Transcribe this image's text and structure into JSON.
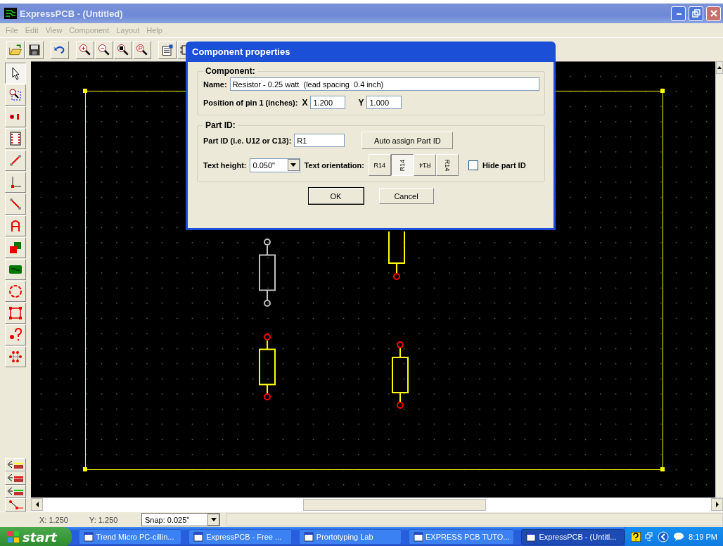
{
  "window": {
    "title": "ExpressPCB - (Untitled)"
  },
  "menu": [
    "File",
    "Edit",
    "View",
    "Component",
    "Layout",
    "Help"
  ],
  "tools": [
    {
      "selected": true
    },
    {
      "selected": false
    },
    {
      "selected": false
    },
    {
      "selected": false
    },
    {
      "selected": false
    },
    {
      "selected": false
    },
    {
      "selected": false
    },
    {
      "selected": false
    },
    {
      "selected": false
    },
    {
      "selected": false
    },
    {
      "selected": false
    },
    {
      "selected": false
    },
    {
      "selected": false
    },
    {
      "selected": false
    }
  ],
  "components": [
    {
      "selected": true
    },
    {
      "selected": false
    },
    {
      "selected": false
    },
    {
      "selected": false
    }
  ],
  "dialog": {
    "title": "Component properties",
    "component_group": {
      "label": "Component:",
      "name_label": "Name:",
      "name_value": "Resistor - 0.25 watt  (lead spacing  0.4 inch)",
      "position_label": "Position of pin 1 (inches):",
      "x_label": "X",
      "x_value": "1.200",
      "y_label": "Y",
      "y_value": "1.000"
    },
    "part_group": {
      "label": "Part ID:",
      "part_id_label": "Part ID (i.e. U12 or C13):",
      "part_id_value": "R1",
      "auto_button": "Auto assign Part ID",
      "text_height_label": "Text height:",
      "text_height_value": "0.050\"",
      "orientation_label": "Text orientation:",
      "orientations": [
        {
          "label": "R14",
          "kind": "upright",
          "selected": false
        },
        {
          "label": "R14",
          "kind": "ccw",
          "selected": true
        },
        {
          "label": "R14",
          "kind": "flipped",
          "selected": false
        },
        {
          "label": "R14",
          "kind": "cw",
          "selected": false
        }
      ],
      "hide_label": "Hide part ID",
      "hide_checked": false
    },
    "buttons": [
      "OK",
      "Cancel"
    ]
  },
  "status_bar": {
    "x": "X: 1.250",
    "y": "Y: 1.250",
    "snap": "Snap:  0.025\""
  },
  "taskbar": {
    "start": "start",
    "items": [
      {
        "label": "Trend Micro PC-cillin...",
        "selected": false
      },
      {
        "label": "ExpressPCB - Free ...",
        "selected": false
      },
      {
        "label": "Prortotyping Lab",
        "selected": false
      },
      {
        "label": "EXPRESS PCB TUTO...",
        "selected": false
      },
      {
        "label": "ExpressPCB - (Untitl...",
        "selected": true
      }
    ],
    "clock": "8:19 PM"
  }
}
